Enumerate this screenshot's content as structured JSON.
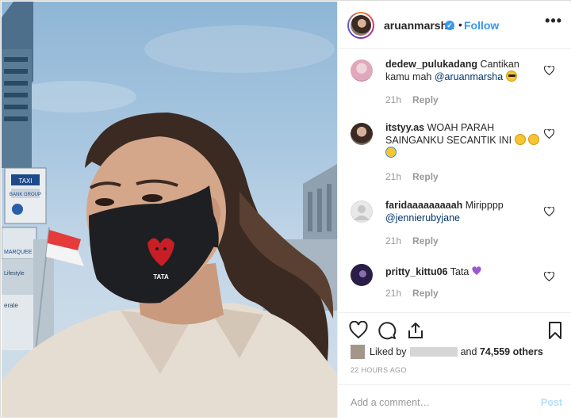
{
  "post": {
    "username": "aruanmarsha",
    "verified_mark": "✓",
    "separator": "•",
    "follow_label": "Follow",
    "more_label": "•••"
  },
  "photo": {
    "mask_label": "TATA",
    "billboard_labels": [
      "TAXI",
      "BANK GROUP",
      "MARQUEE",
      "erale",
      "Lifestyle"
    ]
  },
  "comments": [
    {
      "user": "dedew_pulukadang",
      "text_before": "Cantikan kamu mah ",
      "mention": "@aruanmarsha",
      "text_after": "",
      "emoji": "sunglasses",
      "time": "21h",
      "reply": "Reply"
    },
    {
      "user": "itstyy.as",
      "text_before": "WOAH PARAH SAINGANKU SECANTIK INI",
      "mention": "",
      "text_after": "",
      "emoji": "faces",
      "time": "21h",
      "reply": "Reply"
    },
    {
      "user": "faridaaaaaaaaah",
      "text_before": "Miripppp ",
      "mention": "@jennierubyjane",
      "text_after": "",
      "emoji": "",
      "time": "21h",
      "reply": "Reply"
    },
    {
      "user": "pritty_kittu06",
      "text_before": "Tata",
      "mention": "",
      "text_after": "",
      "emoji": "purple-heart",
      "time": "21h",
      "reply": "Reply"
    }
  ],
  "likes": {
    "prefix": "Liked by",
    "conjunction": "and",
    "count": "74,559 others"
  },
  "timestamp": "22 HOURS AGO",
  "add_comment": {
    "placeholder": "Add a comment…",
    "post_label": "Post"
  },
  "colors": {
    "accent": "#3897f0",
    "post_disabled": "#b2dffc"
  }
}
